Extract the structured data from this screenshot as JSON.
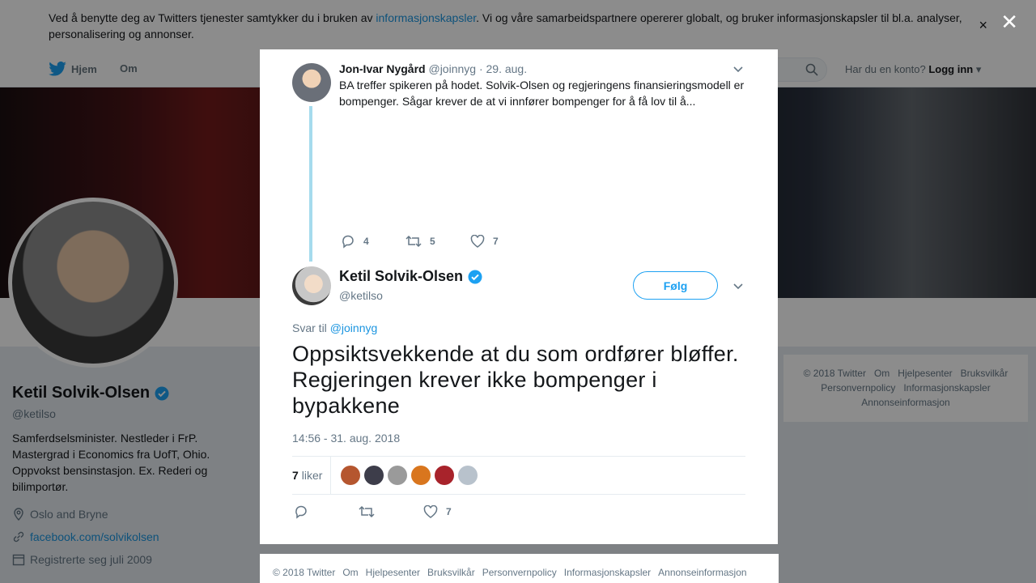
{
  "cookie_banner": {
    "text_before": "Ved å benytte deg av Twitters tjenester samtykker du i bruken av ",
    "link": "informasjonskapsler",
    "text_after": ". Vi og våre samarbeidspartnere opererer globalt, og bruker informasjonskapsler til bl.a. analyser, personalisering og annonser.",
    "close": "×"
  },
  "nav": {
    "home": "Hjem",
    "about": "Om",
    "account_prompt": "Har du en konto?",
    "login": "Logg inn"
  },
  "overlay_close": "✕",
  "profile": {
    "name": "Ketil Solvik-Olsen",
    "handle": "@ketilso",
    "bio": "Samferdselsminister. Nestleder i FrP. Mastergrad i Economics fra UofT, Ohio. Oppvokst bensinstasjon. Ex. Rederi og bilimportør.",
    "location": "Oslo and Bryne",
    "website": "facebook.com/solvikolsen",
    "joined": "Registrerte seg juli 2009"
  },
  "right_footer": {
    "items": [
      "© 2018 Twitter",
      "Om",
      "Hjelpesenter",
      "Bruksvilkår",
      "Personvernpolicy",
      "Informasjonskapsler",
      "Annonseinformasjon"
    ]
  },
  "parent_tweet": {
    "name": "Jon-Ivar Nygård",
    "handle": "@joinnyg",
    "date": "· 29. aug.",
    "text": "BA treffer spikeren på hodet. Solvik-Olsen og regjeringens finansieringsmodell er bompenger. Sågar krever de at vi innfører bompenger for å få lov til å...",
    "replies": "4",
    "retweets": "5",
    "likes": "7"
  },
  "main_tweet": {
    "name": "Ketil Solvik-Olsen",
    "handle": "@ketilso",
    "follow": "Følg",
    "reply_label": "Svar til",
    "reply_handle": "@joinnyg",
    "text": "Oppsiktsvekkende at du som ordfører bløffer. Regjeringen krever ikke bompenger i bypakkene",
    "timestamp": "14:56 - 31. aug. 2018",
    "likes_count": "7",
    "likes_label": "liker",
    "action_likes": "7",
    "liker_colors": [
      "#b5562f",
      "#3d3d4a",
      "#9a9a9a",
      "#d9761e",
      "#a8232b",
      "#b8c2cc"
    ]
  },
  "modal_footer": {
    "items": [
      "© 2018 Twitter",
      "Om",
      "Hjelpesenter",
      "Bruksvilkår",
      "Personvernpolicy",
      "Informasjonskapsler",
      "Annonseinformasjon"
    ]
  },
  "colors": {
    "accent": "#1da1f2",
    "link": "#1b95e0",
    "muted": "#657786",
    "thread_line": "#a5dbed"
  }
}
